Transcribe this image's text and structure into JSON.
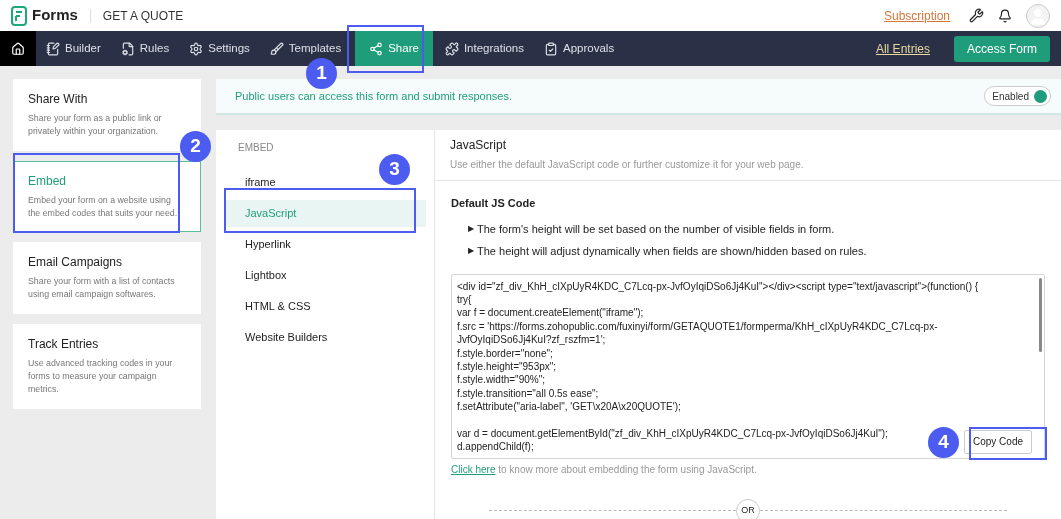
{
  "header": {
    "app_name": "Forms",
    "form_title": "GET A QUOTE",
    "subscription_link": "Subscription"
  },
  "nav": {
    "tabs": [
      {
        "label": "Builder",
        "selected": false
      },
      {
        "label": "Rules",
        "selected": false
      },
      {
        "label": "Settings",
        "selected": false
      },
      {
        "label": "Templates",
        "selected": false
      },
      {
        "label": "Share",
        "selected": true
      },
      {
        "label": "Integrations",
        "selected": false
      },
      {
        "label": "Approvals",
        "selected": false
      }
    ],
    "all_entries_link": "All Entries",
    "access_button": "Access Form"
  },
  "share_options": [
    {
      "title": "Share With",
      "description": "Share your form as a public link or privately within your organization.",
      "selected": false
    },
    {
      "title": "Embed",
      "description": "Embed your form on a website using the embed codes that suits your need.",
      "selected": true
    },
    {
      "title": "Email Campaigns",
      "description": "Share your form with a list of contacts using email campaign softwares.",
      "selected": false
    },
    {
      "title": "Track Entries",
      "description": "Use advanced tracking codes in your forms to measure your campaign metrics.",
      "selected": false
    }
  ],
  "banner": {
    "message": "Public users can access this form and submit responses.",
    "toggle_label": "Enabled",
    "on": true
  },
  "embed_menu": {
    "heading": "EMBED",
    "items": [
      {
        "label": "iframe",
        "selected": false
      },
      {
        "label": "JavaScript",
        "selected": true
      },
      {
        "label": "Hyperlink",
        "selected": false
      },
      {
        "label": "Lightbox",
        "selected": false
      },
      {
        "label": "HTML & CSS",
        "selected": false
      },
      {
        "label": "Website Builders",
        "selected": false
      }
    ]
  },
  "content": {
    "title": "JavaScript",
    "subtitle": "Use either the default JavaScript code or further customize it for your web page.",
    "section_title": "Default JS Code",
    "notes": [
      "The form's height will be set based on the number of visible fields in form.",
      "The height will adjust dynamically when fields are shown/hidden based on rules."
    ],
    "bullet": "▶",
    "code_blocks": [
      [
        "<div id=\"zf_div_KhH_cIXpUyR4KDC_C7Lcq-px-JvfOyIqiDSo6Jj4KuI\"></div><script type=\"text/javascript\">(function() {",
        "try{",
        "var f = document.createElement(\"iframe\");",
        "f.src = 'https://forms.zohopublic.com/fuxinyi/form/GETAQUOTE1/formperma/KhH_cIXpUyR4KDC_C7Lcq-px-JvfOyIqiDSo6Jj4KuI?zf_rszfm=1';",
        "f.style.border=\"none\";",
        "f.style.height=\"953px\";",
        "f.style.width=\"90%\";",
        "f.style.transition=\"all 0.5s ease\";",
        "f.setAttribute(\"aria-label\", 'GET\\x20A\\x20QUOTE');"
      ],
      [
        "var d = document.getElementById(\"zf_div_KhH_cIXpUyR4KDC_C7Lcq-px-JvfOyIqiDSo6Jj4KuI\");",
        "d.appendChild(f);"
      ]
    ],
    "copy_button": "Copy Code",
    "help_link": "Click here",
    "help_text": "to know more about embedding the form using JavaScript.",
    "divider_label": "OR"
  },
  "callouts": [
    "1",
    "2",
    "3",
    "4"
  ]
}
